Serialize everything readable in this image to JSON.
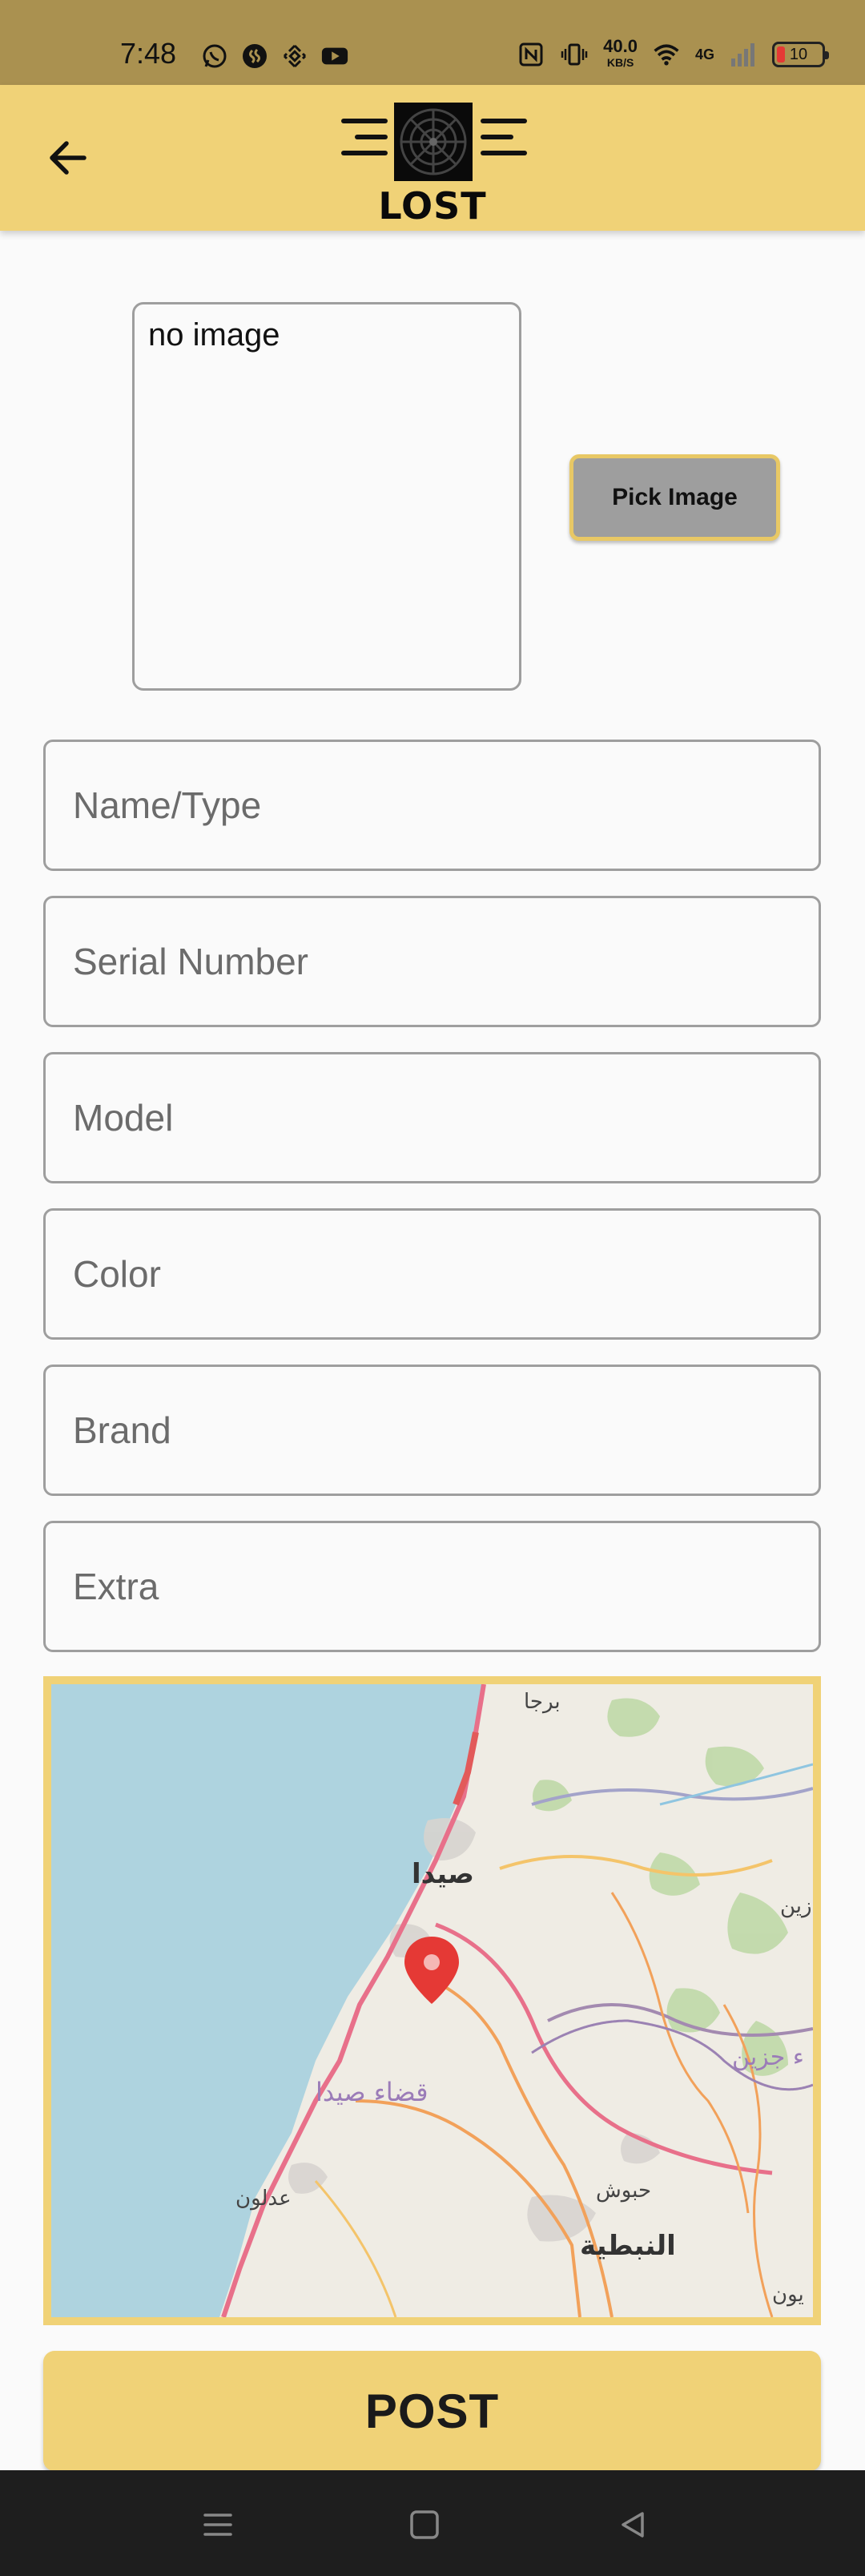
{
  "status_bar": {
    "time": "7:48",
    "net_speed": "40.0",
    "net_speed_unit": "KB/S",
    "network_type": "4G",
    "battery_level": "10",
    "icons": [
      "whatsapp-icon",
      "shazam-icon",
      "binance-icon",
      "youtube-icon",
      "nfc-icon",
      "vibrate-icon",
      "wifi-icon",
      "signal-icon",
      "battery-icon"
    ]
  },
  "app_bar": {
    "logo_text": "LOST",
    "back_icon": "arrow-left-icon"
  },
  "image_picker": {
    "preview_text": "no image",
    "pick_button_label": "Pick Image"
  },
  "form": {
    "name_placeholder": "Name/Type",
    "serial_placeholder": "Serial Number",
    "model_placeholder": "Model",
    "color_placeholder": "Color",
    "brand_placeholder": "Brand",
    "extra_placeholder": "Extra"
  },
  "map": {
    "labels": {
      "barja": "برجا",
      "saida": "صيدا",
      "jezzine_partial": "زين",
      "jezzine_district_partial": "ء جزين",
      "saida_district": "قضاء صيدا",
      "adloun": "عدلون",
      "habboush": "حبوش",
      "nabatieh": "النبطية",
      "yoon_partial": "يون"
    },
    "marker_icon": "map-pin-icon"
  },
  "actions": {
    "post_label": "POST"
  },
  "nav_bar": {
    "icons": [
      "menu-icon",
      "home-square-icon",
      "back-triangle-icon"
    ]
  },
  "colors": {
    "accent": "#f0d277",
    "status_bar": "#aa9150",
    "pick_button": "#9e9e9e",
    "marker": "#e53935",
    "sea": "#aed3df"
  }
}
